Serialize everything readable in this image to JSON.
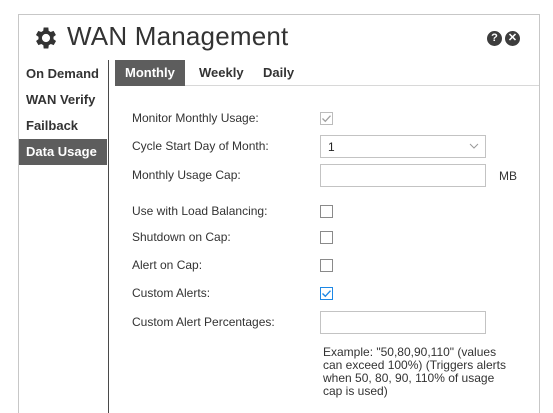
{
  "window": {
    "title": "WAN Management",
    "help_label": "?",
    "close_label": "✕"
  },
  "sidebar": {
    "items": [
      {
        "label": "On Demand"
      },
      {
        "label": "WAN Verify"
      },
      {
        "label": "Failback"
      },
      {
        "label": "Data Usage",
        "active": true
      }
    ]
  },
  "tabs": [
    {
      "label": "Monthly",
      "active": true
    },
    {
      "label": "Weekly"
    },
    {
      "label": "Daily"
    }
  ],
  "form": {
    "monitor_monthly_usage": {
      "label": "Monitor Monthly Usage:",
      "checked": true,
      "disabled": true
    },
    "cycle_start_day": {
      "label": "Cycle Start Day of Month:",
      "value": "1"
    },
    "monthly_usage_cap": {
      "label": "Monthly Usage Cap:",
      "value": "",
      "unit": "MB"
    },
    "use_with_load_balancing": {
      "label": "Use with Load Balancing:",
      "checked": false
    },
    "shutdown_on_cap": {
      "label": "Shutdown on Cap:",
      "checked": false
    },
    "alert_on_cap": {
      "label": "Alert on Cap:",
      "checked": false
    },
    "custom_alerts": {
      "label": "Custom Alerts:",
      "checked": true
    },
    "custom_alert_percentages": {
      "label": "Custom Alert Percentages:",
      "value": ""
    },
    "help_text": "Example: \"50,80,90,110\" (values can exceed 100%) (Triggers alerts when 50, 80, 90, 110% of usage cap is used)"
  },
  "colors": {
    "active_tab_bg": "#5d5d5d",
    "checkbox_checked": "#1e88e5",
    "checkbox_disabled_check": "#a0a0a0"
  }
}
